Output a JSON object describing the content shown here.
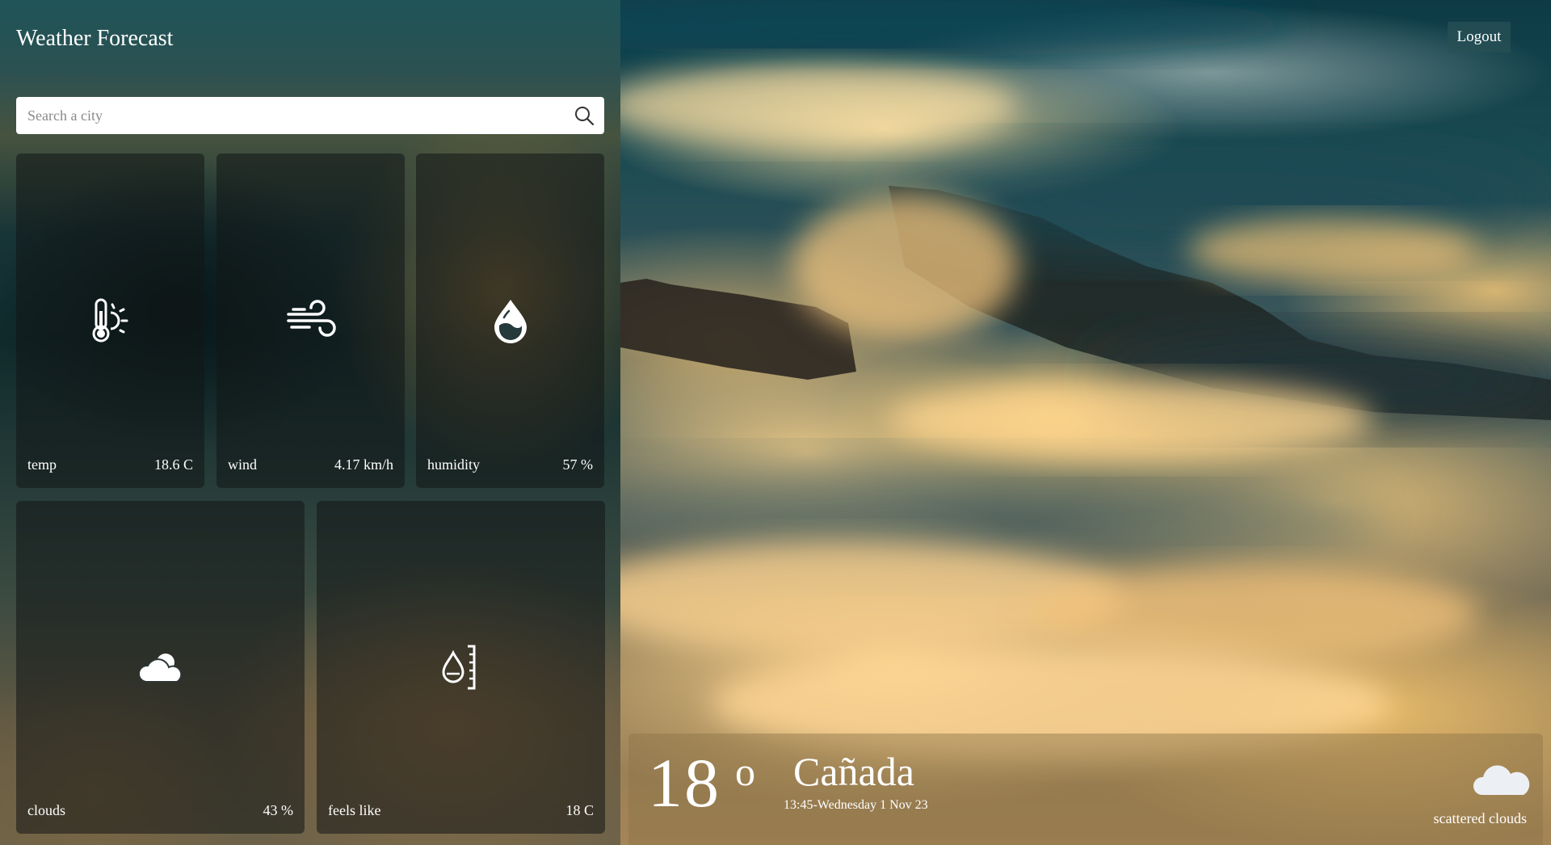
{
  "app": {
    "title": "Weather Forecast"
  },
  "search": {
    "placeholder": "Search a city",
    "value": "",
    "icon": "search-icon"
  },
  "header": {
    "logout_label": "Logout"
  },
  "cards": [
    {
      "label": "temp",
      "value": "18.6 C",
      "icon": "thermometer-sun-icon"
    },
    {
      "label": "wind",
      "value": "4.17 km/h",
      "icon": "wind-icon"
    },
    {
      "label": "humidity",
      "value": "57 %",
      "icon": "water-drop-icon"
    },
    {
      "label": "clouds",
      "value": "43 %",
      "icon": "cloud-sun-icon"
    },
    {
      "label": "feels like",
      "value": "18 C",
      "icon": "drop-gauge-icon"
    }
  ],
  "current": {
    "temperature": "18",
    "degree_symbol": "o",
    "city": "Cañada",
    "datetime": "13:45-Wednesday 1 Nov 23",
    "condition": "scattered clouds",
    "condition_icon": "cloud-icon"
  },
  "colors": {
    "text": "#ffffff",
    "search_background": "#ffffff",
    "card_background": "rgba(18,22,22,0.55)",
    "logout_background": "rgba(40,80,85,0.75)"
  }
}
